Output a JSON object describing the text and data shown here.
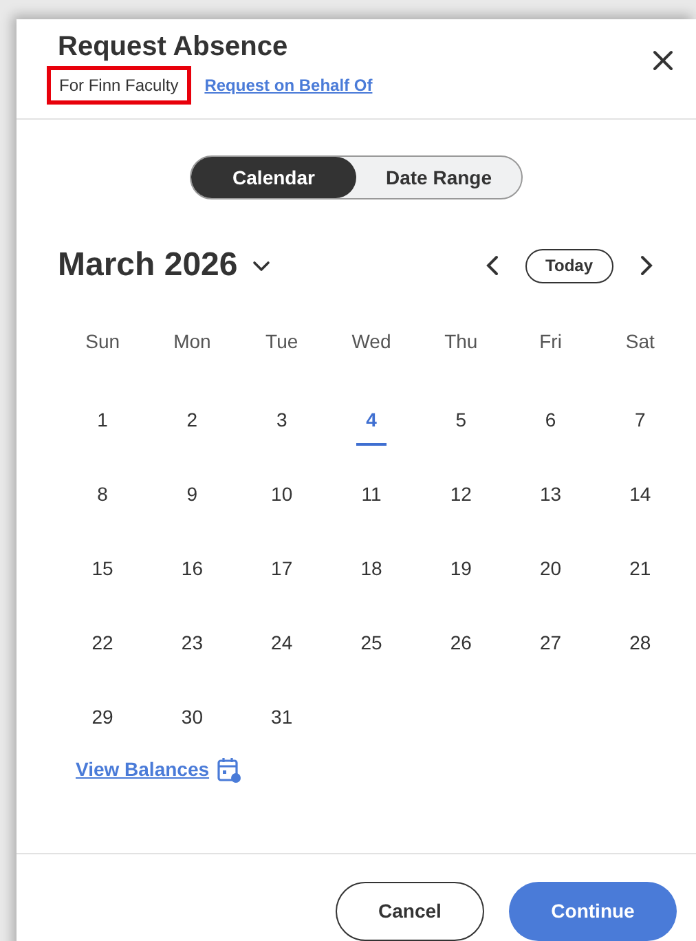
{
  "dialog": {
    "title": "Request Absence",
    "subtitle": {
      "text": "For Finn Faculty",
      "highlighted": true
    },
    "link": "Request on Behalf Of"
  },
  "view_toggle": [
    {
      "label": "Calendar",
      "selected": true
    },
    {
      "label": "Date Range",
      "selected": false
    }
  ],
  "calendar": {
    "month": "March 2026",
    "today_button": "Today",
    "weekdays": [
      "Sun",
      "Mon",
      "Tue",
      "Wed",
      "Thu",
      "Fri",
      "Sat"
    ],
    "weeks": [
      [
        {
          "day": "1",
          "today": false
        },
        {
          "day": "2",
          "today": false
        },
        {
          "day": "3",
          "today": false
        },
        {
          "day": "4",
          "today": true
        },
        {
          "day": "5",
          "today": false
        },
        {
          "day": "6",
          "today": false
        },
        {
          "day": "7",
          "today": false
        }
      ],
      [
        {
          "day": "8",
          "today": false
        },
        {
          "day": "9",
          "today": false
        },
        {
          "day": "10",
          "today": false
        },
        {
          "day": "11",
          "today": false
        },
        {
          "day": "12",
          "today": false
        },
        {
          "day": "13",
          "today": false
        },
        {
          "day": "14",
          "today": false
        }
      ],
      [
        {
          "day": "15",
          "today": false
        },
        {
          "day": "16",
          "today": false
        },
        {
          "day": "17",
          "today": false
        },
        {
          "day": "18",
          "today": false
        },
        {
          "day": "19",
          "today": false
        },
        {
          "day": "20",
          "today": false
        },
        {
          "day": "21",
          "today": false
        }
      ],
      [
        {
          "day": "22",
          "today": false
        },
        {
          "day": "23",
          "today": false
        },
        {
          "day": "24",
          "today": false
        },
        {
          "day": "25",
          "today": false
        },
        {
          "day": "26",
          "today": false
        },
        {
          "day": "27",
          "today": false
        },
        {
          "day": "28",
          "today": false
        }
      ],
      [
        {
          "day": "29",
          "today": false
        },
        {
          "day": "30",
          "today": false
        },
        {
          "day": "31",
          "today": false
        }
      ]
    ]
  },
  "view_balances": "View Balances",
  "buttons": [
    {
      "label": "Cancel",
      "kind": "secondary"
    },
    {
      "label": "Continue",
      "kind": "primary"
    }
  ]
}
